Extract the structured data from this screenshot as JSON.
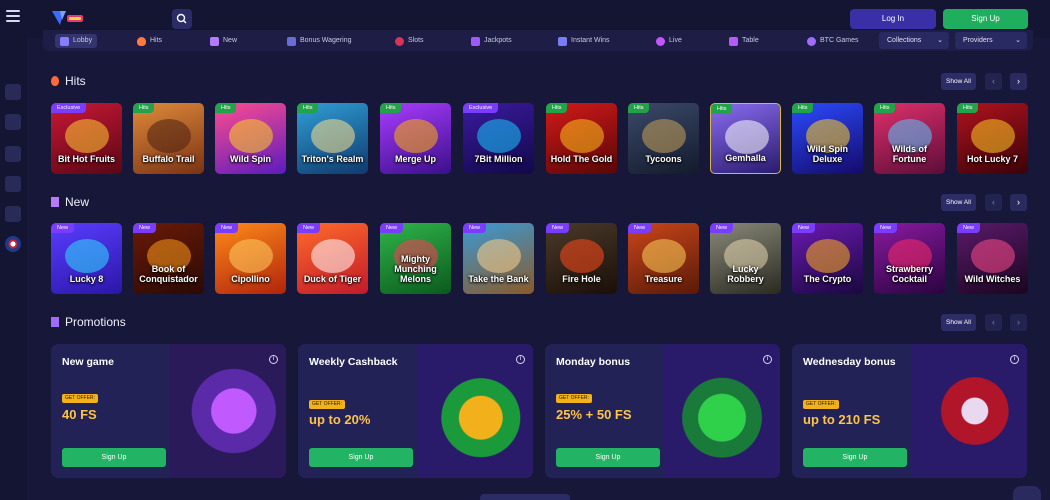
{
  "header": {
    "login_label": "Log In",
    "signup_label": "Sign Up"
  },
  "categories": [
    {
      "label": "Lobby",
      "icon": "dice-icon",
      "active": true
    },
    {
      "label": "Hits",
      "icon": "flame-icon"
    },
    {
      "label": "New",
      "icon": "sparkle-icon"
    },
    {
      "label": "Bonus Wagering",
      "icon": "bonus-icon"
    },
    {
      "label": "Slots",
      "icon": "cherry-icon"
    },
    {
      "label": "Jackpots",
      "icon": "jackpot-icon"
    },
    {
      "label": "Instant Wins",
      "icon": "rocket-icon"
    },
    {
      "label": "Live",
      "icon": "live-icon"
    },
    {
      "label": "Table",
      "icon": "cards-icon"
    },
    {
      "label": "BTC Games",
      "icon": "bitcoin-icon"
    }
  ],
  "filters": {
    "collections_label": "Collections",
    "providers_label": "Providers"
  },
  "hits": {
    "title": "Hits",
    "show_all": "Show All",
    "games": [
      {
        "name": "Bit Hot Fruits",
        "badge": "Exclusive"
      },
      {
        "name": "Buffalo Trail",
        "badge": "Hits"
      },
      {
        "name": "Wild Spin",
        "badge": "Hits"
      },
      {
        "name": "Triton's Realm",
        "badge": "Hits"
      },
      {
        "name": "Merge Up",
        "badge": "Hits"
      },
      {
        "name": "7Bit Million",
        "badge": "Exclusive"
      },
      {
        "name": "Hold The Gold",
        "badge": "Hits"
      },
      {
        "name": "Tycoons",
        "badge": "Hits"
      },
      {
        "name": "Gemhalla",
        "badge": "Hits"
      },
      {
        "name": "Wild Spin Deluxe",
        "badge": "Hits"
      },
      {
        "name": "Wilds of Fortune",
        "badge": "Hits"
      },
      {
        "name": "Hot Lucky 7",
        "badge": "Hits"
      }
    ]
  },
  "new": {
    "title": "New",
    "show_all": "Show All",
    "games": [
      {
        "name": "Lucky 8",
        "badge": "New"
      },
      {
        "name": "Book of Conquistador",
        "badge": "New"
      },
      {
        "name": "Cipollino",
        "badge": "New"
      },
      {
        "name": "Duck of Tiger",
        "badge": "New"
      },
      {
        "name": "Mighty Munching Melons",
        "badge": "New"
      },
      {
        "name": "Take the Bank",
        "badge": "New"
      },
      {
        "name": "Fire Hole",
        "badge": "New"
      },
      {
        "name": "Treasure",
        "badge": "New"
      },
      {
        "name": "Lucky Robbery",
        "badge": "New"
      },
      {
        "name": "The Crypto",
        "badge": "New"
      },
      {
        "name": "Strawberry Cocktail",
        "badge": "New"
      },
      {
        "name": "Wild Witches",
        "badge": "New"
      }
    ]
  },
  "promotions": {
    "title": "Promotions",
    "show_all": "Show All",
    "items": [
      {
        "title": "New game",
        "offer": "GET OFFER:",
        "value": "40 FS",
        "cta": "Sign Up"
      },
      {
        "title": "Weekly Cashback",
        "offer": "GET OFFER:",
        "value": "up to 20%",
        "cta": "Sign Up"
      },
      {
        "title": "Monday bonus",
        "offer": "GET OFFER:",
        "value": "25% + 50 FS",
        "cta": "Sign Up"
      },
      {
        "title": "Wednesday bonus",
        "offer": "GET OFFER:",
        "value": "up to 210 FS",
        "cta": "Sign Up"
      }
    ]
  }
}
